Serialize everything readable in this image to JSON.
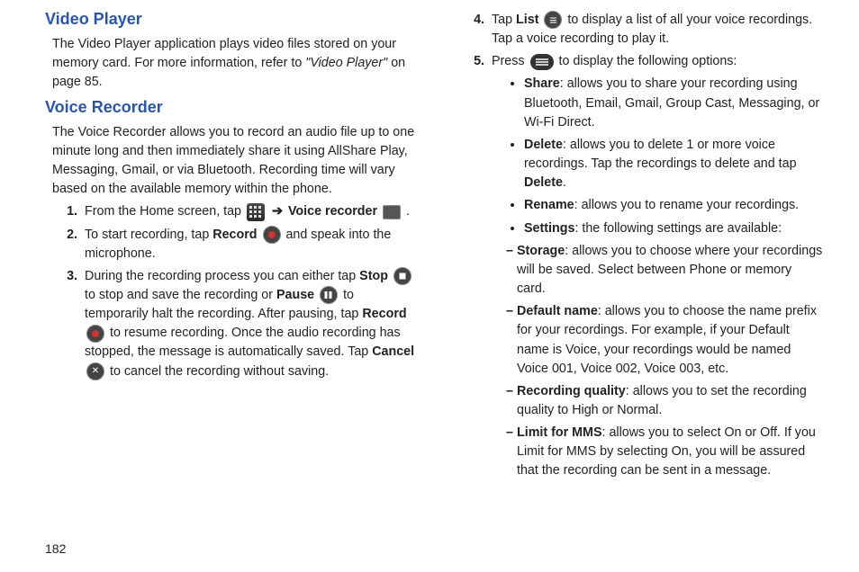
{
  "left": {
    "h1": "Video Player",
    "p1a": "The Video Player application plays video files stored on your memory card. For more information, refer to ",
    "p1b": "\"Video Player\"",
    "p1c": " on page 85.",
    "h2": "Voice Recorder",
    "p2": "The Voice Recorder allows you to record an audio file up to one minute long and then immediately share it using AllShare Play, Messaging, Gmail, or via Bluetooth. Recording time will vary based on the available memory within the phone.",
    "s1a": "From the Home screen, tap ",
    "s1b": "Voice recorder",
    "s2a": "To start recording, tap ",
    "s2b": "Record",
    "s2c": " and speak into the microphone.",
    "s3a": "During the recording process you can either tap ",
    "s3b": "Stop",
    "s3c": " to stop and save the recording or ",
    "s3d": "Pause",
    "s3e": " to temporarily halt the recording. After pausing, tap ",
    "s3f": "Record",
    "s3g": " to resume recording. Once the audio recording has stopped, the message is automatically saved. Tap ",
    "s3h": "Cancel",
    "s3i": " to cancel the recording without saving."
  },
  "right": {
    "s4a": "Tap ",
    "s4b": "List",
    "s4c": " to display a list of all your voice recordings. Tap a voice recording to play it.",
    "s5a": "Press ",
    "s5b": " to display the following options:",
    "b_share_t": "Share",
    "b_share": ": allows you to share your recording using Bluetooth, Email, Gmail, Group Cast, Messaging, or Wi-Fi Direct.",
    "b_delete_t": "Delete",
    "b_delete": ": allows you to delete 1 or more voice recordings. Tap the recordings to delete and tap ",
    "b_delete2": "Delete",
    "b_rename_t": "Rename",
    "b_rename": ": allows you to rename your recordings.",
    "b_settings_t": "Settings",
    "b_settings": ": the following settings are available:",
    "d_storage_t": "Storage",
    "d_storage": ": allows you to choose where your recordings will be saved. Select between Phone or memory card.",
    "d_default_t": "Default name",
    "d_default": ": allows you to choose the name prefix for your recordings. For example, if your Default name is Voice, your recordings would be named Voice 001, Voice 002, Voice 003, etc.",
    "d_quality_t": "Recording quality",
    "d_quality": ": allows you to set the recording quality to High or Normal.",
    "d_limit_t": "Limit for MMS",
    "d_limit": ": allows you to select On or Off. If you Limit for MMS by selecting On, you will be assured that the recording can be sent in a message."
  },
  "pagenum": "182",
  "arrow": "➔"
}
